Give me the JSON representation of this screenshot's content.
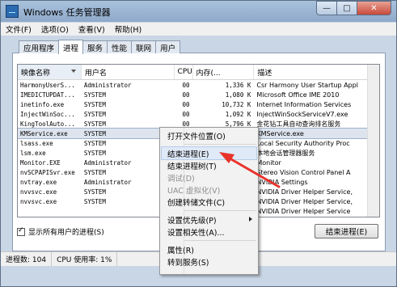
{
  "window": {
    "title": "Windows 任务管理器",
    "btn_min": "—",
    "btn_max": "□",
    "btn_close": "✕"
  },
  "menu": [
    "文件(F)",
    "选项(O)",
    "查看(V)",
    "帮助(H)"
  ],
  "tabs": [
    "应用程序",
    "进程",
    "服务",
    "性能",
    "联网",
    "用户"
  ],
  "active_tab": 1,
  "columns": {
    "name": "映像名称",
    "user": "用户名",
    "cpu": "CPU",
    "mem": "内存(...",
    "desc": "描述"
  },
  "rows": [
    [
      "HarmonyUserS...",
      "Administrator",
      "00",
      "1,336 K",
      "Csr Harmony User Startup Appl"
    ],
    [
      "IMEDICTUPDAT...",
      "SYSTEM",
      "00",
      "1,080 K",
      "Microsoft Office IME 2010"
    ],
    [
      "inetinfo.exe",
      "SYSTEM",
      "00",
      "10,732 K",
      "Internet Information Services"
    ],
    [
      "InjectWinSoc...",
      "SYSTEM",
      "00",
      "1,092 K",
      "InjectWinSockServiceV7.exe"
    ],
    [
      "KingToolAuto...",
      "SYSTEM",
      "00",
      "5,796 K",
      "金花钻工具自动查询排名服务"
    ],
    [
      "KMService.exe",
      "SYSTEM",
      "",
      "",
      "KMService.exe"
    ],
    [
      "lsass.exe",
      "SYSTEM",
      "",
      "",
      "Local Security Authority Proc"
    ],
    [
      "lsm.exe",
      "SYSTEM",
      "",
      "",
      "本地会话管理器服务"
    ],
    [
      "Monitor.EXE",
      "Administrator",
      "",
      "",
      "Monitor"
    ],
    [
      "nvSCPAPISvr.exe",
      "SYSTEM",
      "",
      "",
      "Stereo Vision Control Panel A"
    ],
    [
      "nvtray.exe",
      "Administrator",
      "",
      "",
      "NVIDIA Settings"
    ],
    [
      "nvvsvc.exe",
      "SYSTEM",
      "",
      "",
      "NVIDIA Driver Helper Service,"
    ],
    [
      "nvvsvc.exe",
      "SYSTEM",
      "",
      "",
      "NVIDIA Driver Helper Service,"
    ],
    [
      "",
      "",
      "",
      "",
      "NVIDIA Driver Helper Service"
    ]
  ],
  "show_all_label": "显示所有用户的进程(S)",
  "end_process_button": "结束进程(E)",
  "status": {
    "processes": "进程数: 104",
    "cpu": "CPU 使用率: 1%"
  },
  "context_menu": {
    "items": [
      "打开文件位置(O)",
      "sep",
      "结束进程(E)",
      "结束进程树(T)",
      "调试(D)",
      "UAC 虚拟化(V)",
      "创建转储文件(C)",
      "sep",
      "设置优先级(P)",
      "设置相关性(A)...",
      "sep",
      "属性(R)",
      "转到服务(S)"
    ],
    "disabled": [
      "调试(D)",
      "UAC 虚拟化(V)"
    ],
    "highlighted": "结束进程(E)",
    "submenu": [
      "设置优先级(P)"
    ]
  },
  "colors": {
    "arrow": "#e8322b",
    "highlight": "#dfe9f7"
  }
}
